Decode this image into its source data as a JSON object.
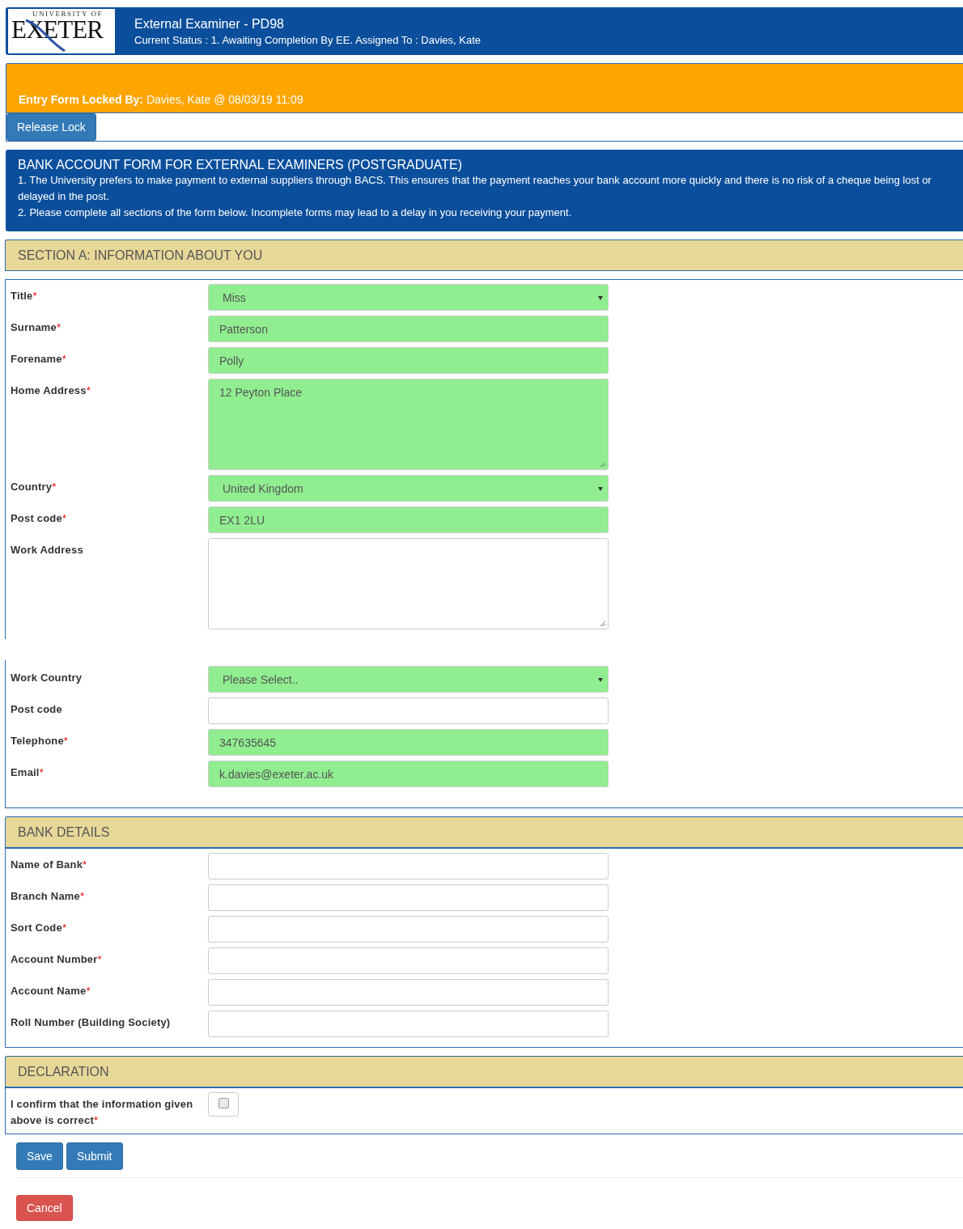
{
  "header": {
    "logo_top": "UNIVERSITY OF",
    "logo_word": "EXETER",
    "title": "External Examiner - PD98",
    "status": "Current Status : 1. Awaiting Completion By EE. Assigned To : Davies, Kate"
  },
  "lock": {
    "label": "Entry Form Locked By:",
    "value": "Davies, Kate @ 08/03/19 11:09",
    "button": "Release Lock"
  },
  "info": {
    "title": "BANK ACCOUNT FORM FOR EXTERNAL EXAMINERS (POSTGRADUATE)",
    "lines": [
      "1. The University prefers to make payment to external suppliers through BACS. This ensures that the payment reaches your bank account more quickly and there is no risk of a cheque being lost or delayed in the post.",
      "2. Please complete all sections of the form below. Incomplete forms may lead to a delay in you receiving your payment."
    ]
  },
  "sections": [
    {
      "title": "SECTION A: INFORMATION ABOUT YOU",
      "groups": [
        {
          "fields": [
            {
              "label": "Title",
              "mark": "*",
              "kind": "select",
              "value": "Miss",
              "highlighted": true
            },
            {
              "label": "Surname",
              "mark": "*",
              "kind": "text",
              "value": "Patterson",
              "highlighted": true
            },
            {
              "label": "Forename",
              "mark": "*",
              "kind": "text",
              "value": "Polly",
              "highlighted": true
            },
            {
              "label": "Home Address",
              "mark": "*",
              "kind": "textarea",
              "value": "12 Peyton Place",
              "highlighted": true
            },
            {
              "label": "Country",
              "mark": "*",
              "kind": "select",
              "value": "United Kingdom",
              "highlighted": true
            },
            {
              "label": "Post code",
              "mark": "*",
              "kind": "text",
              "value": "EX1 2LU",
              "highlighted": true
            },
            {
              "label": "Work Address",
              "kind": "textarea",
              "highlighted": false
            }
          ]
        },
        {
          "fields": [
            {
              "label": "Work Country",
              "kind": "select",
              "value": "Please Select..",
              "highlighted": true
            },
            {
              "label": "Post code",
              "kind": "text",
              "highlighted": false
            },
            {
              "label": "Telephone",
              "mark": "*",
              "kind": "text",
              "value": "347635645",
              "highlighted": true
            },
            {
              "label": "Email",
              "mark": "*",
              "kind": "text",
              "value": "k.davies@exeter.ac.uk",
              "highlighted": true
            }
          ]
        }
      ]
    },
    {
      "title": "BANK DETAILS",
      "groups": [
        {
          "fields": [
            {
              "label": "Name of Bank",
              "mark": "*",
              "kind": "text",
              "highlighted": false
            },
            {
              "label": "Branch Name",
              "mark": "*",
              "kind": "text",
              "highlighted": false
            },
            {
              "label": "Sort Code",
              "mark": "*",
              "kind": "text",
              "highlighted": false
            },
            {
              "label": "Account Number",
              "mark": "*",
              "kind": "text",
              "highlighted": false
            },
            {
              "label": "Account Name",
              "mark": "*",
              "kind": "text",
              "highlighted": false
            },
            {
              "label": "Roll Number (Building Society)",
              "kind": "text",
              "highlighted": false
            }
          ]
        }
      ]
    },
    {
      "title": "DECLARATION",
      "groups": [
        {
          "fields": [
            {
              "label": "I confirm that the information given above is correct",
              "mark": "*",
              "kind": "checkbox",
              "checked": false
            }
          ]
        }
      ]
    }
  ],
  "actions": [
    {
      "label": "Save",
      "kind": "primary"
    },
    {
      "label": "Submit",
      "kind": "primary"
    }
  ],
  "cancel": {
    "label": "Cancel"
  }
}
